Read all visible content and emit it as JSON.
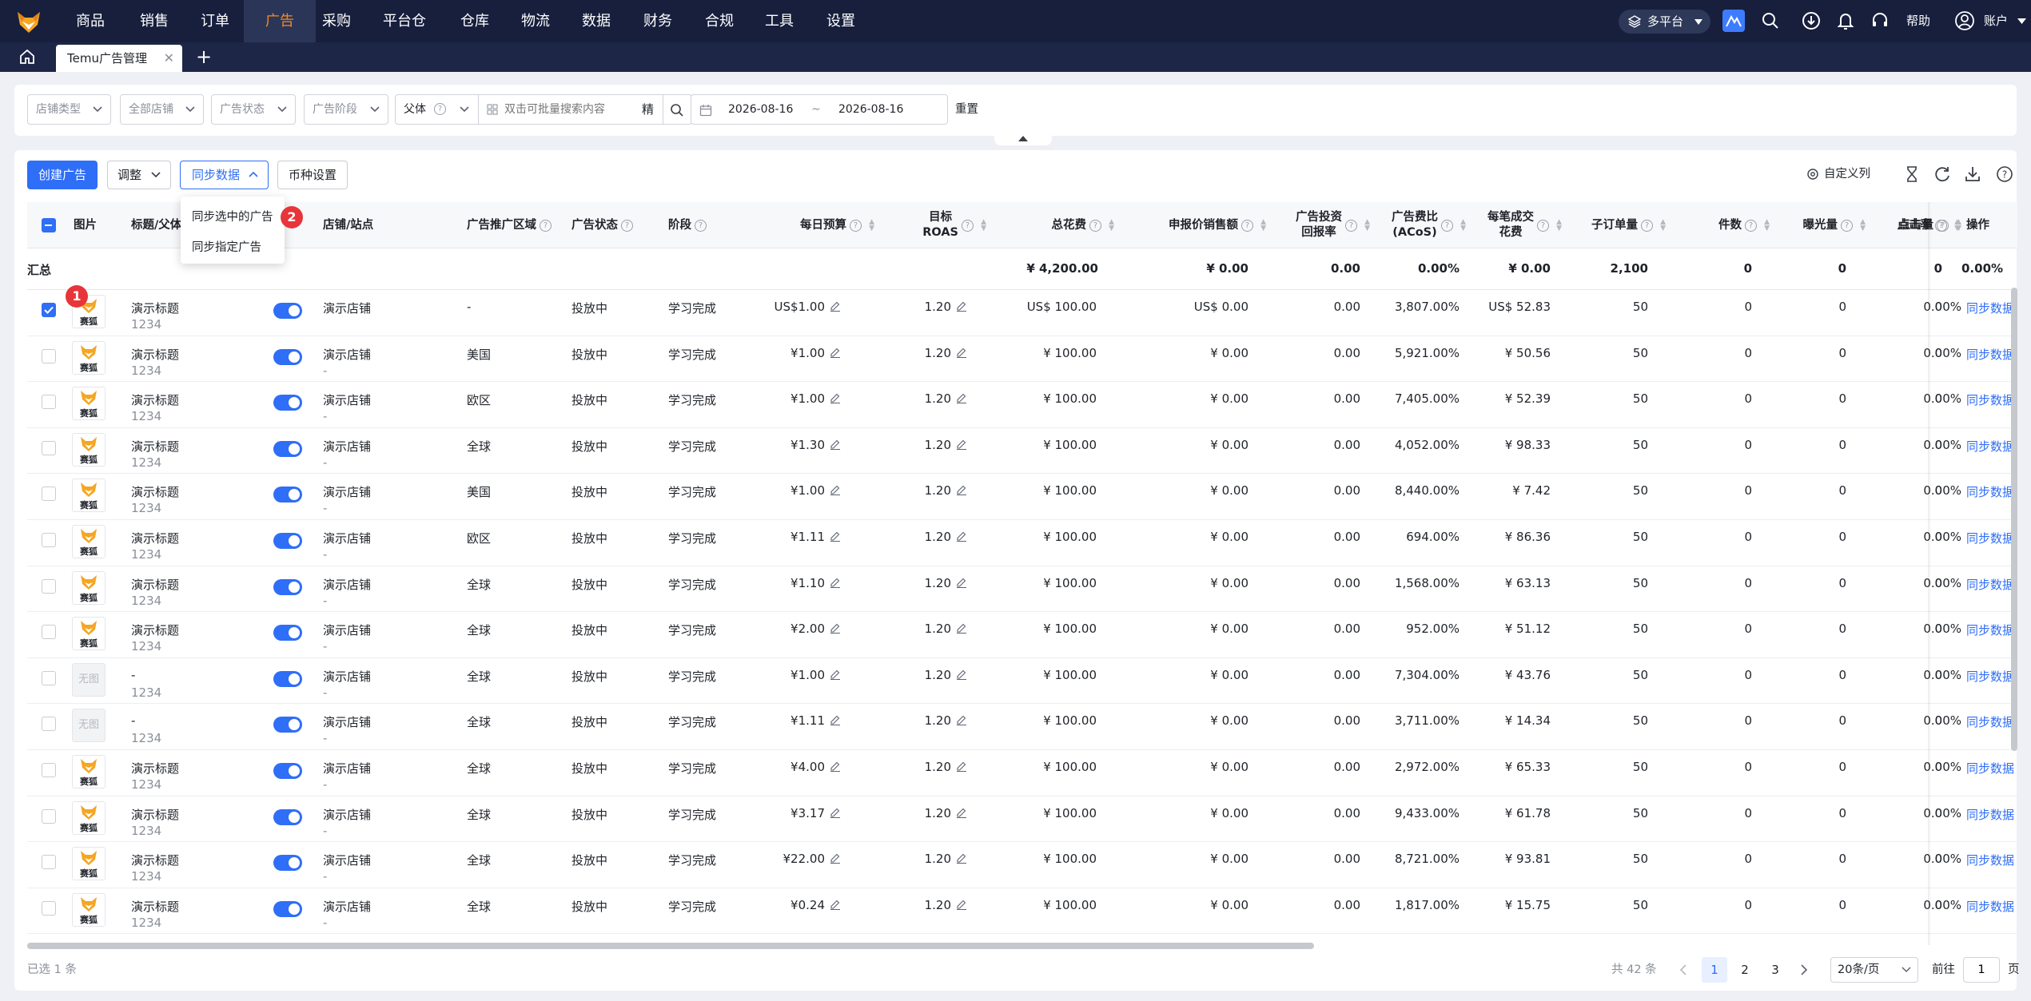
{
  "nav": {
    "items": [
      "商品",
      "销售",
      "订单",
      "广告",
      "采购",
      "平台仓",
      "仓库",
      "物流",
      "数据",
      "财务",
      "合规",
      "工具",
      "设置"
    ],
    "active_index": 3,
    "platform": "多平台",
    "help": "帮助",
    "account": "账户"
  },
  "tabs": {
    "active": "Temu广告管理"
  },
  "filters": {
    "store_type": "店铺类型",
    "all_stores": "全部店铺",
    "ad_status": "广告状态",
    "ad_stage": "广告阶段",
    "parent_select": "父体",
    "search_placeholder": "双击可批量搜索内容",
    "precise": "精",
    "date_start": "2026-08-16",
    "date_sep": "~",
    "date_end": "2026-08-16",
    "reset": "重置"
  },
  "toolbar": {
    "create": "创建广告",
    "adjust": "调整",
    "sync": "同步数据",
    "currency": "币种设置",
    "custom_cols": "自定义列"
  },
  "dropdown": {
    "items": [
      "同步选中的广告",
      "同步指定广告"
    ],
    "badge1": "1",
    "badge2": "2"
  },
  "table": {
    "headers": {
      "image": "图片",
      "title": "标题/父体",
      "store": "店铺/站点",
      "region": "广告推广区域",
      "status": "广告状态",
      "stage": "阶段",
      "budget": "每日预算",
      "roas_line1": "目标",
      "roas_line2": "ROAS",
      "spend": "总花费",
      "declared_sales": "申报价销售额",
      "roi_line1": "广告投资",
      "roi_line2": "回报率",
      "acos_line1": "广告费比",
      "acos_line2": "(ACoS)",
      "cpo_line1": "每笔成交",
      "cpo_line2": "花费",
      "orders": "子订单量",
      "pieces": "件数",
      "impressions": "曝光量",
      "clicks": "点击量",
      "ctr": "点击率",
      "actions": "操作"
    },
    "summary": {
      "label": "汇总",
      "spend": "¥ 4,200.00",
      "declared_sales": "¥ 0.00",
      "roi": "0.00",
      "acos": "0.00%",
      "cpo": "¥ 0.00",
      "orders": "2,100",
      "pieces": "0",
      "impressions": "0",
      "clicks": "0",
      "ctr": "0.00%"
    },
    "rows": [
      {
        "checked": true,
        "img": "logo",
        "title": "演示标题",
        "parent": "1234",
        "store": "演示店铺",
        "site": "",
        "region": "-",
        "status": "投放中",
        "stage": "学习完成",
        "budget": "US$1.00",
        "roas": "1.20",
        "spend": "US$ 100.00",
        "sales": "US$ 0.00",
        "roi": "0.00",
        "acos": "3,807.00%",
        "cpo": "US$ 52.83",
        "orders": "50",
        "pieces": "0",
        "impr": "0",
        "clicks": "0",
        "ctr": "0.00%",
        "op": "同步数据"
      },
      {
        "checked": false,
        "img": "logo",
        "title": "演示标题",
        "parent": "1234",
        "store": "演示店铺",
        "site": "-",
        "region": "美国",
        "status": "投放中",
        "stage": "学习完成",
        "budget": "¥1.00",
        "roas": "1.20",
        "spend": "¥ 100.00",
        "sales": "¥ 0.00",
        "roi": "0.00",
        "acos": "5,921.00%",
        "cpo": "¥ 50.56",
        "orders": "50",
        "pieces": "0",
        "impr": "0",
        "clicks": "0",
        "ctr": "0.00%",
        "op": "同步数据"
      },
      {
        "checked": false,
        "img": "logo",
        "title": "演示标题",
        "parent": "1234",
        "store": "演示店铺",
        "site": "-",
        "region": "欧区",
        "status": "投放中",
        "stage": "学习完成",
        "budget": "¥1.00",
        "roas": "1.20",
        "spend": "¥ 100.00",
        "sales": "¥ 0.00",
        "roi": "0.00",
        "acos": "7,405.00%",
        "cpo": "¥ 52.39",
        "orders": "50",
        "pieces": "0",
        "impr": "0",
        "clicks": "0",
        "ctr": "0.00%",
        "op": "同步数据"
      },
      {
        "checked": false,
        "img": "logo",
        "title": "演示标题",
        "parent": "1234",
        "store": "演示店铺",
        "site": "-",
        "region": "全球",
        "status": "投放中",
        "stage": "学习完成",
        "budget": "¥1.30",
        "roas": "1.20",
        "spend": "¥ 100.00",
        "sales": "¥ 0.00",
        "roi": "0.00",
        "acos": "4,052.00%",
        "cpo": "¥ 98.33",
        "orders": "50",
        "pieces": "0",
        "impr": "0",
        "clicks": "0",
        "ctr": "0.00%",
        "op": "同步数据"
      },
      {
        "checked": false,
        "img": "logo",
        "title": "演示标题",
        "parent": "1234",
        "store": "演示店铺",
        "site": "-",
        "region": "美国",
        "status": "投放中",
        "stage": "学习完成",
        "budget": "¥1.00",
        "roas": "1.20",
        "spend": "¥ 100.00",
        "sales": "¥ 0.00",
        "roi": "0.00",
        "acos": "8,440.00%",
        "cpo": "¥ 7.42",
        "orders": "50",
        "pieces": "0",
        "impr": "0",
        "clicks": "0",
        "ctr": "0.00%",
        "op": "同步数据"
      },
      {
        "checked": false,
        "img": "logo",
        "title": "演示标题",
        "parent": "1234",
        "store": "演示店铺",
        "site": "-",
        "region": "欧区",
        "status": "投放中",
        "stage": "学习完成",
        "budget": "¥1.11",
        "roas": "1.20",
        "spend": "¥ 100.00",
        "sales": "¥ 0.00",
        "roi": "0.00",
        "acos": "694.00%",
        "cpo": "¥ 86.36",
        "orders": "50",
        "pieces": "0",
        "impr": "0",
        "clicks": "0",
        "ctr": "0.00%",
        "op": "同步数据"
      },
      {
        "checked": false,
        "img": "logo",
        "title": "演示标题",
        "parent": "1234",
        "store": "演示店铺",
        "site": "-",
        "region": "全球",
        "status": "投放中",
        "stage": "学习完成",
        "budget": "¥1.10",
        "roas": "1.20",
        "spend": "¥ 100.00",
        "sales": "¥ 0.00",
        "roi": "0.00",
        "acos": "1,568.00%",
        "cpo": "¥ 63.13",
        "orders": "50",
        "pieces": "0",
        "impr": "0",
        "clicks": "0",
        "ctr": "0.00%",
        "op": "同步数据"
      },
      {
        "checked": false,
        "img": "logo",
        "title": "演示标题",
        "parent": "1234",
        "store": "演示店铺",
        "site": "-",
        "region": "全球",
        "status": "投放中",
        "stage": "学习完成",
        "budget": "¥2.00",
        "roas": "1.20",
        "spend": "¥ 100.00",
        "sales": "¥ 0.00",
        "roi": "0.00",
        "acos": "952.00%",
        "cpo": "¥ 51.12",
        "orders": "50",
        "pieces": "0",
        "impr": "0",
        "clicks": "0",
        "ctr": "0.00%",
        "op": "同步数据"
      },
      {
        "checked": false,
        "img": "none",
        "title": "-",
        "parent": "1234",
        "store": "演示店铺",
        "site": "-",
        "region": "全球",
        "status": "投放中",
        "stage": "学习完成",
        "budget": "¥1.00",
        "roas": "1.20",
        "spend": "¥ 100.00",
        "sales": "¥ 0.00",
        "roi": "0.00",
        "acos": "7,304.00%",
        "cpo": "¥ 43.76",
        "orders": "50",
        "pieces": "0",
        "impr": "0",
        "clicks": "0",
        "ctr": "0.00%",
        "op": "同步数据"
      },
      {
        "checked": false,
        "img": "none",
        "title": "-",
        "parent": "1234",
        "store": "演示店铺",
        "site": "-",
        "region": "全球",
        "status": "投放中",
        "stage": "学习完成",
        "budget": "¥1.11",
        "roas": "1.20",
        "spend": "¥ 100.00",
        "sales": "¥ 0.00",
        "roi": "0.00",
        "acos": "3,711.00%",
        "cpo": "¥ 14.34",
        "orders": "50",
        "pieces": "0",
        "impr": "0",
        "clicks": "0",
        "ctr": "0.00%",
        "op": "同步数据"
      },
      {
        "checked": false,
        "img": "logo",
        "title": "演示标题",
        "parent": "1234",
        "store": "演示店铺",
        "site": "-",
        "region": "全球",
        "status": "投放中",
        "stage": "学习完成",
        "budget": "¥4.00",
        "roas": "1.20",
        "spend": "¥ 100.00",
        "sales": "¥ 0.00",
        "roi": "0.00",
        "acos": "2,972.00%",
        "cpo": "¥ 65.33",
        "orders": "50",
        "pieces": "0",
        "impr": "0",
        "clicks": "0",
        "ctr": "0.00%",
        "op": "同步数据"
      },
      {
        "checked": false,
        "img": "logo",
        "title": "演示标题",
        "parent": "1234",
        "store": "演示店铺",
        "site": "-",
        "region": "全球",
        "status": "投放中",
        "stage": "学习完成",
        "budget": "¥3.17",
        "roas": "1.20",
        "spend": "¥ 100.00",
        "sales": "¥ 0.00",
        "roi": "0.00",
        "acos": "9,433.00%",
        "cpo": "¥ 61.78",
        "orders": "50",
        "pieces": "0",
        "impr": "0",
        "clicks": "0",
        "ctr": "0.00%",
        "op": "同步数据"
      },
      {
        "checked": false,
        "img": "logo",
        "title": "演示标题",
        "parent": "1234",
        "store": "演示店铺",
        "site": "-",
        "region": "全球",
        "status": "投放中",
        "stage": "学习完成",
        "budget": "¥22.00",
        "roas": "1.20",
        "spend": "¥ 100.00",
        "sales": "¥ 0.00",
        "roi": "0.00",
        "acos": "8,721.00%",
        "cpo": "¥ 93.81",
        "orders": "50",
        "pieces": "0",
        "impr": "0",
        "clicks": "0",
        "ctr": "0.00%",
        "op": "同步数据"
      },
      {
        "checked": false,
        "img": "logo",
        "title": "演示标题",
        "parent": "1234",
        "store": "演示店铺",
        "site": "-",
        "region": "全球",
        "status": "投放中",
        "stage": "学习完成",
        "budget": "¥0.24",
        "roas": "1.20",
        "spend": "¥ 100.00",
        "sales": "¥ 0.00",
        "roi": "0.00",
        "acos": "1,817.00%",
        "cpo": "¥ 15.75",
        "orders": "50",
        "pieces": "0",
        "impr": "0",
        "clicks": "0",
        "ctr": "0.00%",
        "op": "同步数据"
      }
    ],
    "thumb_caption": "赛狐",
    "no_image": "无图"
  },
  "footer": {
    "selected": "已选 1 条",
    "total": "共 42 条",
    "pages": [
      "1",
      "2",
      "3"
    ],
    "current_page": "1",
    "page_size": "20条/页",
    "goto": "前往",
    "goto_value": "1",
    "page_unit": "页"
  },
  "colors": {
    "nav_bg": "#171f3d",
    "accent": "#2f6ef6",
    "active_nav": "#f58a1f",
    "badge": "#e8353a"
  }
}
